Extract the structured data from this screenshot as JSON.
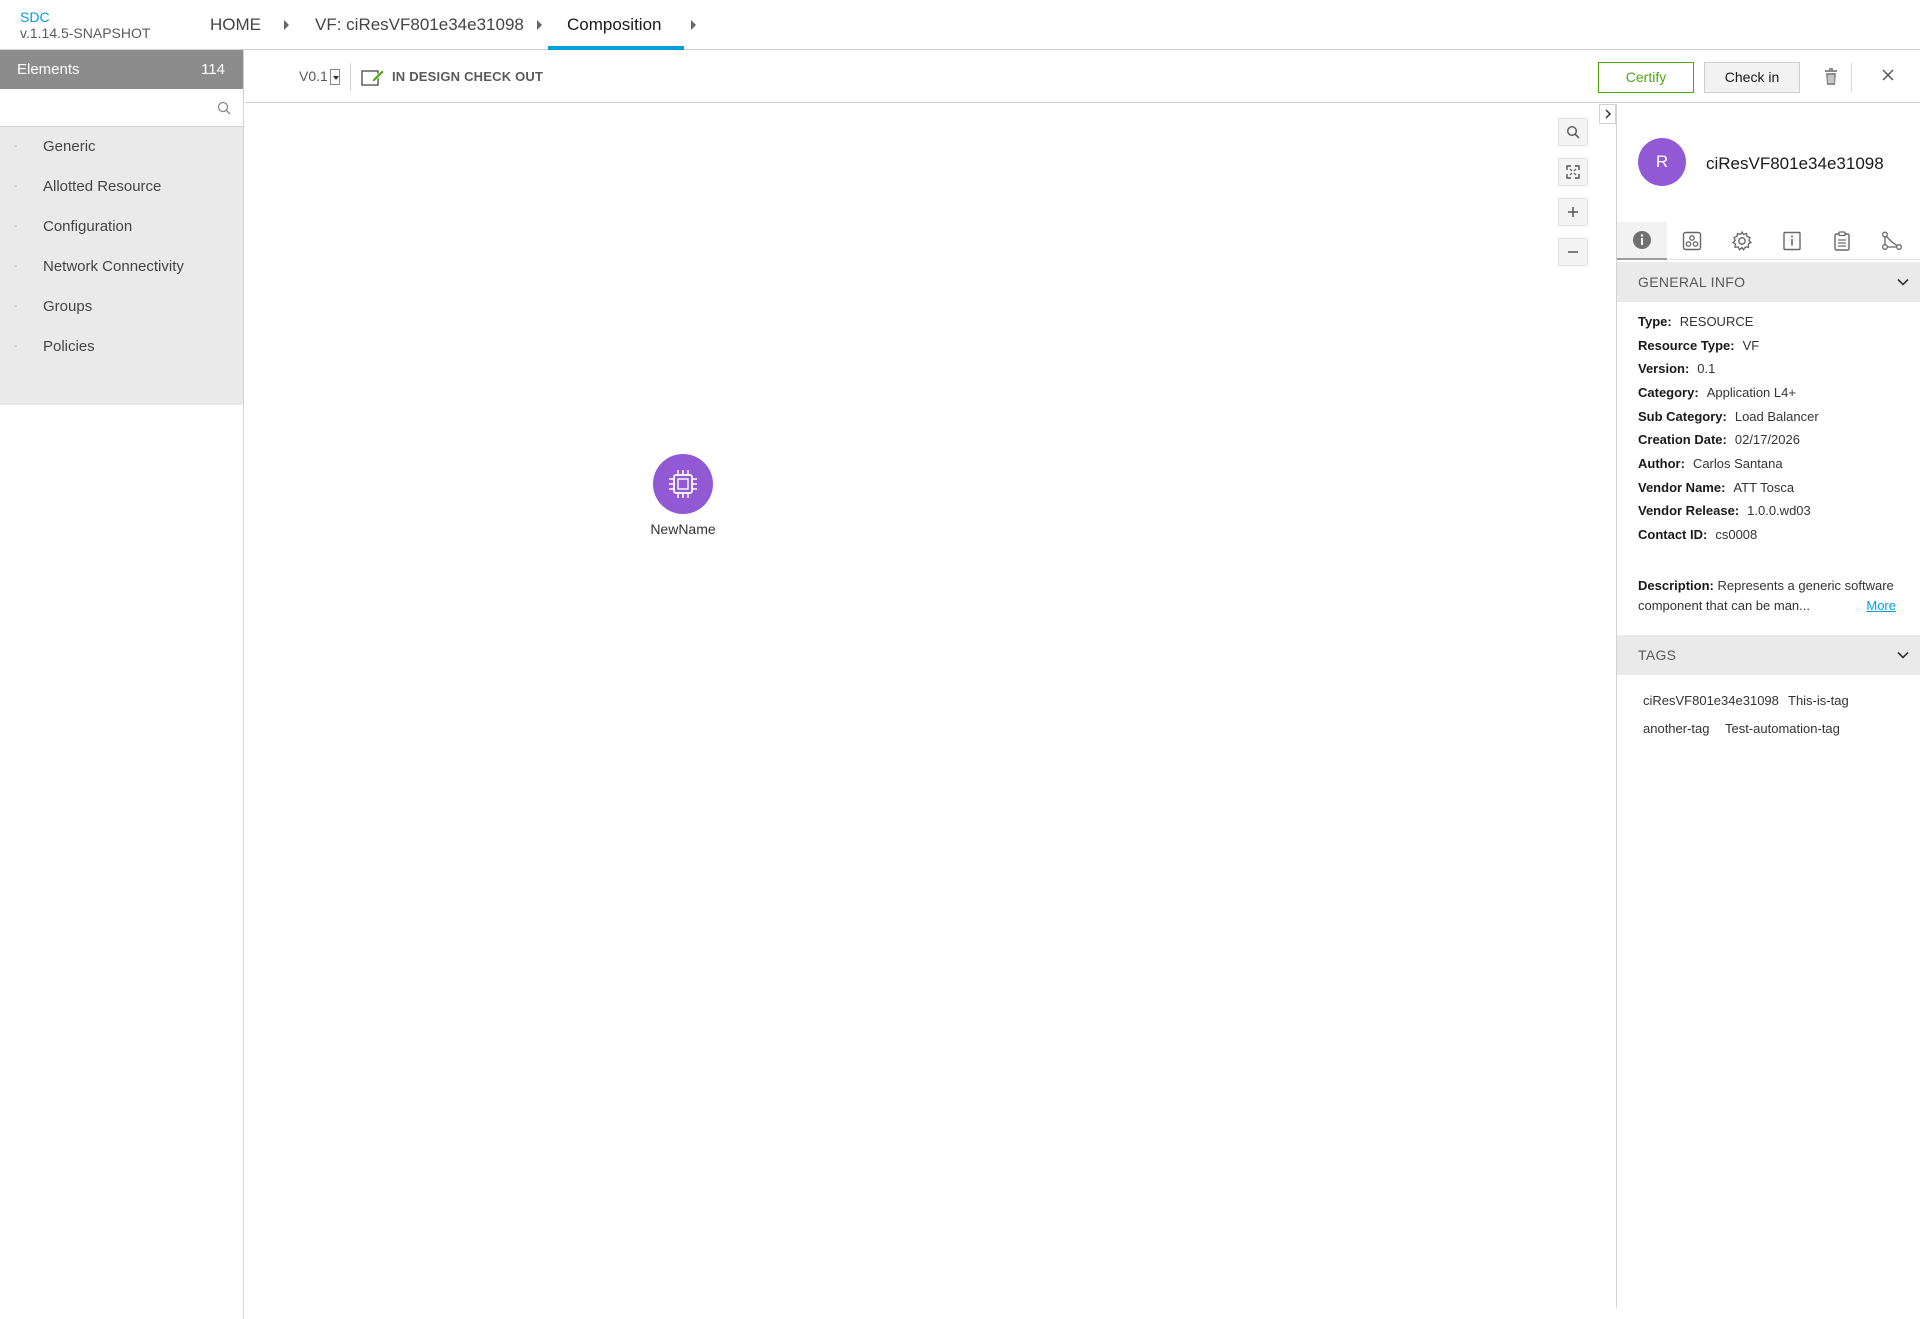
{
  "header": {
    "brand": "SDC",
    "version": "v.1.14.5-SNAPSHOT",
    "breadcrumbs": [
      "HOME",
      "VF: ciResVF801e34e31098",
      "Composition"
    ]
  },
  "palette": {
    "title": "Elements",
    "count": "114",
    "search_placeholder": "",
    "items": [
      {
        "toggle": "-",
        "label": "Generic"
      },
      {
        "toggle": "-",
        "label": "Allotted Resource"
      },
      {
        "toggle": "-",
        "label": "Configuration"
      },
      {
        "toggle": "-",
        "label": "Network Connectivity"
      },
      {
        "toggle": "-",
        "label": "Groups"
      },
      {
        "toggle": "-",
        "label": "Policies"
      }
    ]
  },
  "toolbar": {
    "version": "V0.1",
    "status": "IN DESIGN CHECK OUT",
    "certify_label": "Certify",
    "checkin_label": "Check in",
    "trash_icon": "trash-icon",
    "close_icon": "close-icon"
  },
  "canvas": {
    "node": {
      "label": "NewName",
      "icon": "chip-icon",
      "color": "#9159d4"
    },
    "controls": [
      "search-icon",
      "fit-screen-icon",
      "zoom-in-icon",
      "zoom-out-icon"
    ]
  },
  "details": {
    "avatar_letter": "R",
    "title": "ciResVF801e34e31098",
    "tabs": [
      "info-icon",
      "deployment-icon",
      "properties-icon",
      "details-icon",
      "artifacts-icon",
      "relations-icon"
    ],
    "general_info_title": "GENERAL INFO",
    "fields": [
      {
        "label": "Type:",
        "value": "RESOURCE"
      },
      {
        "label": "Resource Type:",
        "value": "VF"
      },
      {
        "label": "Version:",
        "value": "0.1"
      },
      {
        "label": "Category:",
        "value": "Application L4+"
      },
      {
        "label": "Sub Category:",
        "value": "Load Balancer"
      },
      {
        "label": "Creation Date:",
        "value": "02/17/2026"
      },
      {
        "label": "Author:",
        "value": "Carlos Santana"
      },
      {
        "label": "Vendor Name:",
        "value": "ATT Tosca"
      },
      {
        "label": "Vendor Release:",
        "value": "1.0.0.wd03"
      },
      {
        "label": "Contact ID:",
        "value": "cs0008"
      }
    ],
    "description_label": "Description:",
    "description": "Represents a generic software component that can be man...",
    "more_label": "More",
    "tags_title": "TAGS",
    "tags": [
      "ciResVF801e34e31098",
      "This-is-tag",
      "another-tag",
      "Test-automation-tag"
    ]
  },
  "colors": {
    "accent": "#009fdb",
    "certify": "#4ca90c",
    "node": "#9159d4",
    "palette_header": "#8c8c8c"
  }
}
